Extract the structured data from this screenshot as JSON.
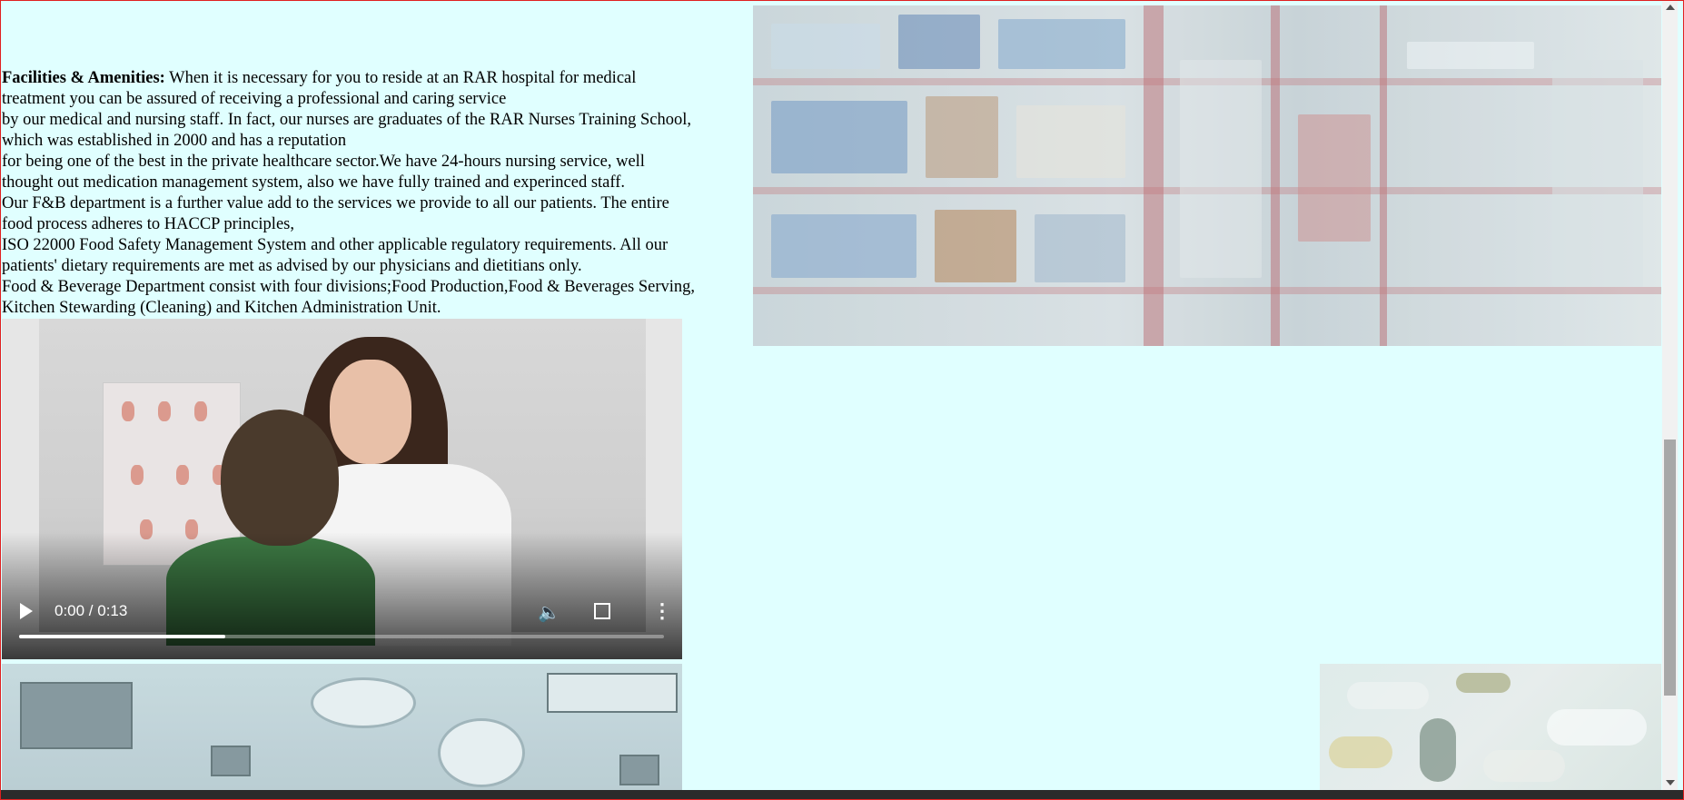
{
  "content": {
    "heading": "Facilities & Amenities:",
    "lines": [
      " When it is necessary for you to reside at an RAR hospital for medical",
      "treatment you can be assured of receiving a professional and caring service",
      "by our medical and nursing staff. In fact, our nurses are graduates of the RAR Nurses Training School,",
      "which was established in 2000 and has a reputation",
      "for being one of the best in the private healthcare sector.We have 24-hours nursing service, well",
      "thought out medication management system, also we have fully trained and experinced staff.",
      "Our F&B department is a further value add to the services we provide to all our patients. The entire",
      "food process adheres to HACCP principles,",
      "ISO 22000 Food Safety Management System and other applicable regulatory requirements. All our",
      "patients' dietary requirements are met as advised by our physicians and dietitians only.",
      "Food & Beverage Department consist with four divisions;Food Production,Food & Beverages Serving,",
      "Kitchen Stewarding (Cleaning) and Kitchen Administration Unit."
    ]
  },
  "video": {
    "time_display": "0:00 / 0:13",
    "progress_fraction": 0.32,
    "play_icon": "play-icon",
    "mute_icon": "volume-icon",
    "fullscreen_icon": "fullscreen-icon",
    "menu_icon": "more-vert-icon"
  },
  "images": {
    "pharmacy": "pharmacy-shelves-image",
    "operating_room": "operating-room-image",
    "pills": "pills-image"
  },
  "colors": {
    "page_background": "#e0ffff",
    "frame_border": "#e02020"
  }
}
